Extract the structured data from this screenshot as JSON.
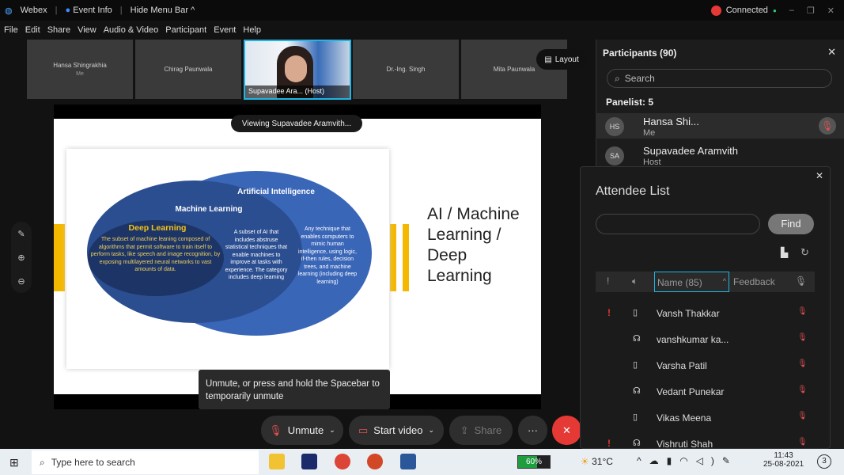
{
  "titlebar": {
    "app": "Webex",
    "event_info": "Event Info",
    "hide_menu": "Hide Menu Bar ^",
    "status": "Connected"
  },
  "menu": [
    "File",
    "Edit",
    "Share",
    "View",
    "Audio & Video",
    "Participant",
    "Event",
    "Help"
  ],
  "videos": [
    {
      "name": "Hansa Shingrakhia",
      "sub": "Me"
    },
    {
      "name": "Chirag Paunwala"
    },
    {
      "name": "Dr.-Ing. Singh"
    },
    {
      "name": "Mita Paunwala"
    }
  ],
  "host_tile": "Supavadee Ara... (Host)",
  "layout_label": "Layout",
  "viewing": "Viewing Supavadee Aramvith...",
  "slide": {
    "title": "AI / Machine Learning / Deep Learning",
    "ai_label": "Artificial Intelligence",
    "ml_label": "Machine Learning",
    "dl_label": "Deep Learning",
    "dl_text": "The subset of machine leaning composed of algorithms that permit software to train itself to perform tasks, like speech and image recognition, by exposing multilayered neural networks to vast amounts of data.",
    "ml_text": "A subset of AI that includes abstruse statistical techniques that enable machines to improve at tasks with experience. The category includes deep learning",
    "ai_text": "Any technique that enables computers to mimic human intelligence, using logic, if-then rules, decision trees, and machine learning (including deep learning)"
  },
  "tooltip": "Unmute, or press and hold the Spacebar to temporarily unmute",
  "controls": {
    "unmute": "Unmute",
    "start_video": "Start video",
    "share": "Share",
    "more": "···",
    "leave": "✕"
  },
  "participants": {
    "title": "Participants (90)",
    "search_placeholder": "Search",
    "panelist_header": "Panelist: 5",
    "rows": [
      {
        "initials": "HS",
        "name": "Hansa Shi...",
        "sub": "Me"
      },
      {
        "initials": "SA",
        "name": "Supavadee Aramvith",
        "sub": "Host"
      }
    ]
  },
  "attendee_list": {
    "title": "Attendee List",
    "find": "Find",
    "columns": {
      "name": "Name (85)",
      "feedback": "Feedback"
    },
    "rows": [
      {
        "name": "Vansh Thakkar",
        "device": "phone",
        "alert": true
      },
      {
        "name": "vanshkumar ka...",
        "device": "headset",
        "alert": false
      },
      {
        "name": "Varsha Patil",
        "device": "phone",
        "alert": false
      },
      {
        "name": "Vedant Punekar",
        "device": "headset",
        "alert": false
      },
      {
        "name": "Vikas Meena",
        "device": "phone",
        "alert": false
      },
      {
        "name": "Vishruti Shah",
        "device": "headset",
        "alert": true
      }
    ]
  },
  "taskbar": {
    "search": "Type here to search",
    "battery": "60%",
    "weather": "31°C",
    "time": "11:43",
    "date": "25-08-2021",
    "notifications": "3"
  },
  "colors": {
    "accent": "#1fb5e6",
    "leave": "#e53935",
    "mute": "#e05050",
    "ellipse": "#3a66b8"
  }
}
